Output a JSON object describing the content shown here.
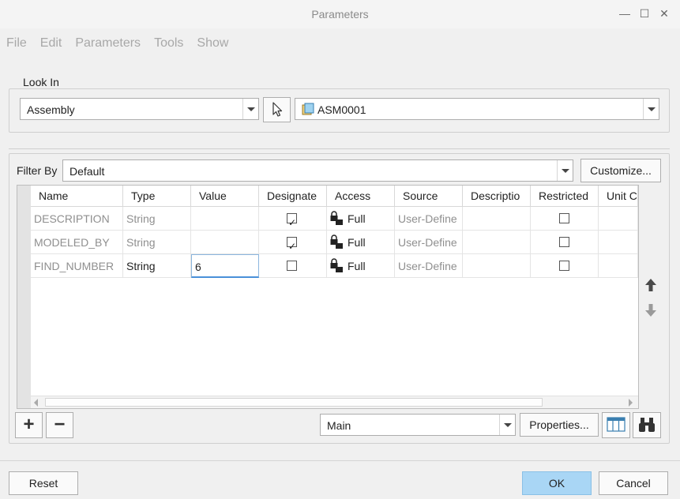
{
  "window": {
    "title": "Parameters",
    "minimize_glyph": "—",
    "maximize_glyph": "☐",
    "close_glyph": "✕"
  },
  "menu": [
    "File",
    "Edit",
    "Parameters",
    "Tools",
    "Show"
  ],
  "look_in": {
    "legend": "Look In",
    "type_value": "Assembly",
    "model_value": "ASM0001"
  },
  "filter": {
    "label": "Filter By",
    "value": "Default",
    "customize_label": "Customize..."
  },
  "table": {
    "columns": [
      "Name",
      "Type",
      "Value",
      "Designate",
      "Access",
      "Source",
      "Descriptio",
      "Restricted",
      "Unit C"
    ],
    "rows": [
      {
        "name": "DESCRIPTION",
        "type": "String",
        "value": "",
        "designate": true,
        "access": "Full",
        "source": "User-Define",
        "description": "",
        "restricted": false
      },
      {
        "name": "MODELED_BY",
        "type": "String",
        "value": "",
        "designate": true,
        "access": "Full",
        "source": "User-Define",
        "description": "",
        "restricted": false
      },
      {
        "name": "FIND_NUMBER",
        "type": "String",
        "value": "6",
        "designate": false,
        "access": "Full",
        "source": "User-Define",
        "description": "",
        "restricted": false
      }
    ]
  },
  "bottom_toolbar": {
    "add_glyph": "+",
    "remove_glyph": "−",
    "view_value": "Main",
    "properties_label": "Properties..."
  },
  "footer": {
    "reset_label": "Reset",
    "ok_label": "OK",
    "cancel_label": "Cancel"
  },
  "colors": {
    "ok_button": "#a9d6f5",
    "disabled_text": "#a8a8a8",
    "edit_border": "#4a90d9"
  },
  "icons": [
    "arrow-select-icon",
    "assembly-icon",
    "lock-icon",
    "up-arrow-icon",
    "down-arrow-icon",
    "columns-icon",
    "binoculars-icon"
  ]
}
